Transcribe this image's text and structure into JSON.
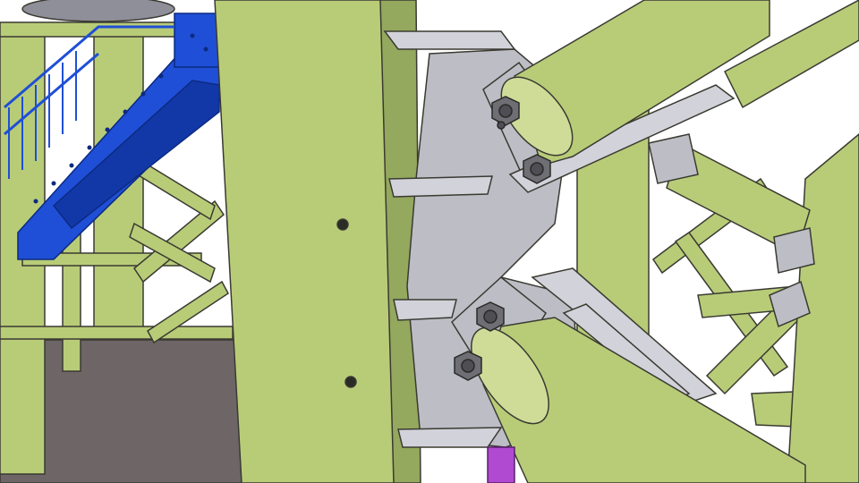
{
  "scene": {
    "subject": "steel-frame-bracing-connection",
    "colors": {
      "background": "#ffffff",
      "steel_member": "#b8cc78",
      "steel_member_dark": "#94a85e",
      "steel_member_light": "#cfdc98",
      "gusset_plate": "#bdbdc6",
      "gusset_plate_dark": "#8f8f9a",
      "bolt": "#6e6e74",
      "stair": "#1f4fd6",
      "stair_dark": "#1238a8",
      "floor_slab": "#6d6566",
      "accent_purple": "#b04ad0",
      "outline": "#3a3a32"
    }
  }
}
